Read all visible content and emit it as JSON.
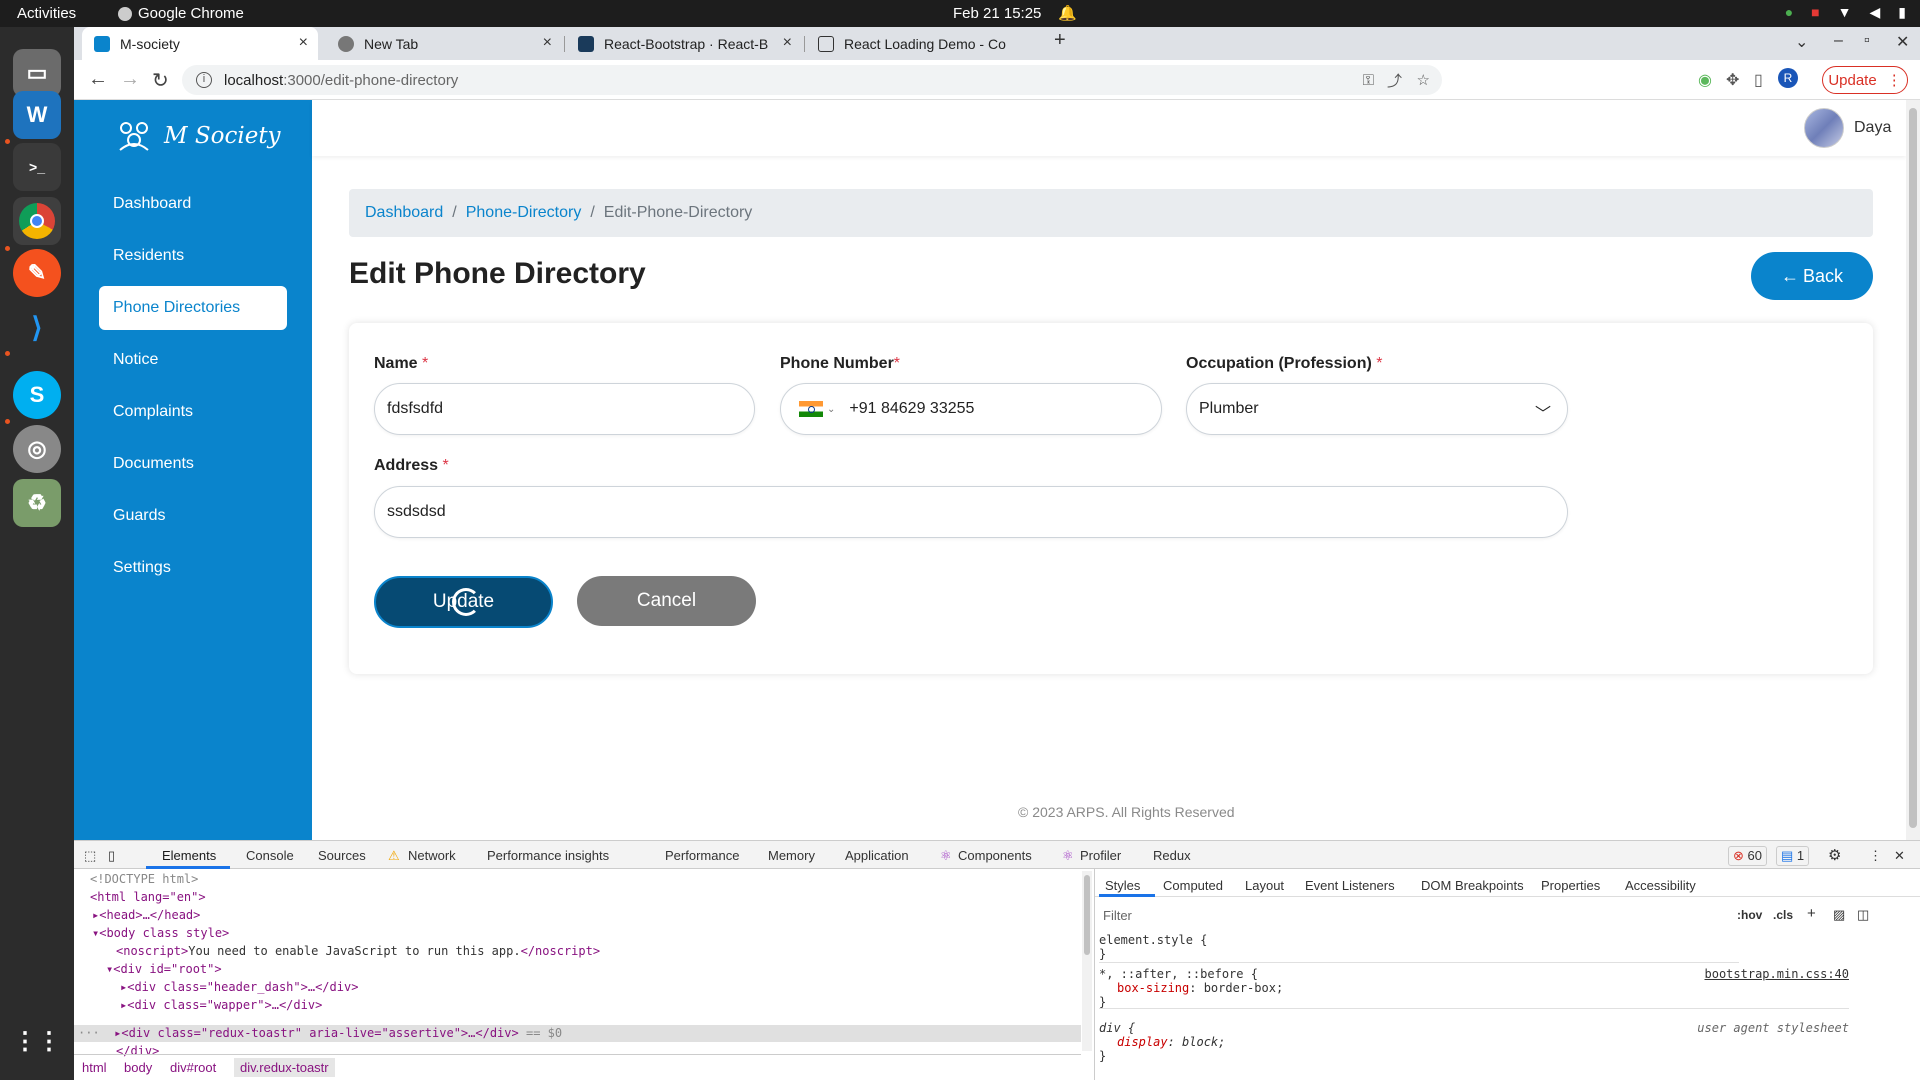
{
  "os": {
    "activities": "Activities",
    "app_name": "Google Chrome",
    "clock": "Feb 21  15:25"
  },
  "browser": {
    "tabs": [
      {
        "title": "M-society",
        "active": true
      },
      {
        "title": "New Tab",
        "active": false
      },
      {
        "title": "React-Bootstrap · React-B",
        "active": false
      },
      {
        "title": "React Loading Demo - Co",
        "active": false
      }
    ],
    "url_host": "localhost",
    "url_path": ":3000/edit-phone-directory",
    "update_label": "Update",
    "profile_initial": "R"
  },
  "app": {
    "logo_text": "M Society",
    "nav": [
      {
        "label": "Dashboard",
        "active": false
      },
      {
        "label": "Residents",
        "active": false
      },
      {
        "label": "Phone Directories",
        "active": true
      },
      {
        "label": "Notice",
        "active": false
      },
      {
        "label": "Complaints",
        "active": false
      },
      {
        "label": "Documents",
        "active": false
      },
      {
        "label": "Guards",
        "active": false
      },
      {
        "label": "Settings",
        "active": false
      }
    ],
    "user_name": "Daya",
    "breadcrumb": {
      "dashboard": "Dashboard",
      "phone_directory": "Phone-Directory",
      "current": "Edit-Phone-Directory",
      "separator": "/"
    },
    "page_title": "Edit Phone Directory",
    "back_label": "Back",
    "form": {
      "name_label": "Name",
      "name_value": "fdsfsdfd",
      "phone_label": "Phone Number",
      "phone_value": "+91 84629 33255",
      "occupation_label": "Occupation (Profession)",
      "occupation_value": "Plumber",
      "address_label": "Address",
      "address_value": "ssdsdsd",
      "required_mark": "*",
      "update_label": "Update",
      "cancel_label": "Cancel"
    },
    "footer": "© 2023 ARPS. All Rights Reserved"
  },
  "devtools": {
    "tabs": [
      "Elements",
      "Console",
      "Sources",
      "Network",
      "Performance insights",
      "Performance",
      "Memory",
      "Application",
      "Components",
      "Profiler",
      "Redux"
    ],
    "error_count": "60",
    "message_count": "1",
    "styles_tabs": [
      "Styles",
      "Computed",
      "Layout",
      "Event Listeners",
      "DOM Breakpoints",
      "Properties",
      "Accessibility"
    ],
    "filter_placeholder": "Filter",
    "hov": ":hov",
    "cls": ".cls",
    "crumbs": [
      "html",
      "body",
      "div#root",
      "div.redux-toastr"
    ],
    "rule1_selector": "element.style {",
    "rule2_selector": "*, ::after, ::before {",
    "rule2_source": "bootstrap.min.css:40",
    "rule2_prop": "box-sizing",
    "rule2_val": "border-box;",
    "rule3_selector": "div {",
    "rule3_source": "user agent stylesheet",
    "rule3_prop": "display",
    "rule3_val": "block;",
    "close_brace": "}",
    "code": {
      "doctype": "<!DOCTYPE html>",
      "html_open": "<html lang=\"en\">",
      "head": "<head>…</head>",
      "body_open": "<body class style>",
      "noscript": "You need to enable JavaScript to run this app.",
      "div_root": "<div id=\"root\">",
      "header_dash": "<div class=\"header_dash\">…</div>",
      "wapper": "<div class=\"wapper\">…</div>",
      "toastr": "<div class=\"redux-toastr\" aria-live=\"assertive\">…</div>",
      "dollar0": "== $0",
      "div_close": "</div>"
    }
  }
}
